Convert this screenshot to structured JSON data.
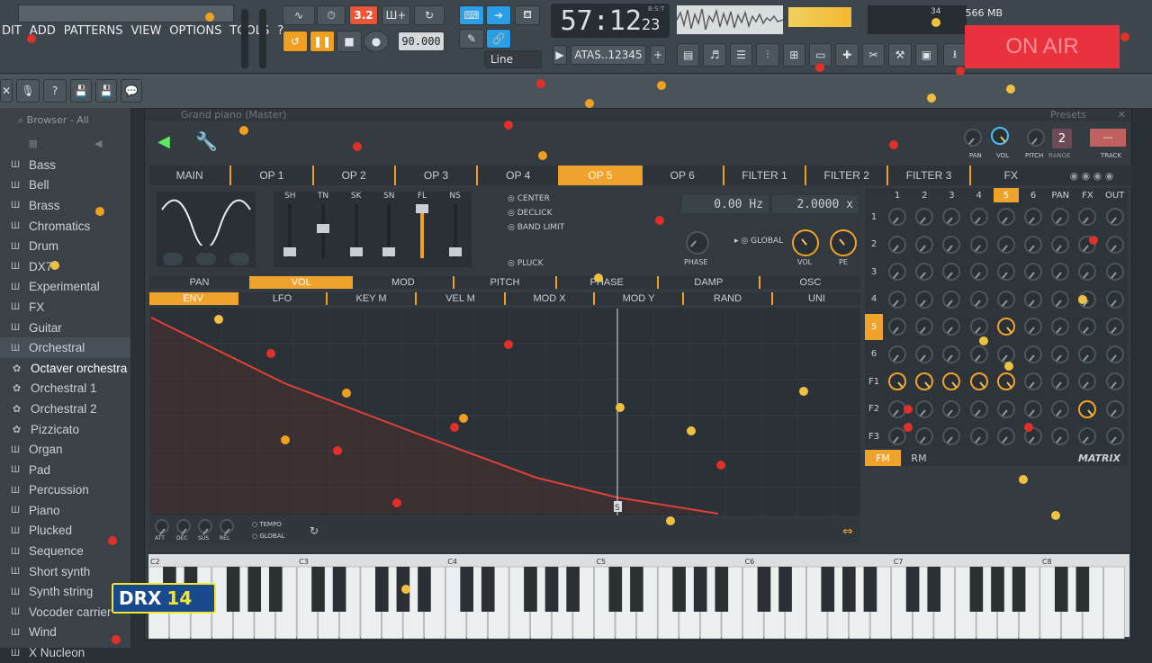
{
  "menu": [
    "DIT",
    "ADD",
    "PATTERNS",
    "VIEW",
    "OPTIONS",
    "TOOLS",
    "?"
  ],
  "transport": {
    "tempo": "90.000",
    "pattern_num": "3.2",
    "time_main": "57:12",
    "time_sub": "23",
    "time_unit": "B:S:T",
    "snap": "Line",
    "song_label": "ATAS..12345",
    "cpu_label": "34",
    "mem_label": "566 MB"
  },
  "on_air": "ON AIR",
  "browser": {
    "header": "Browser - All",
    "items": [
      {
        "label": "Bass",
        "type": "folder"
      },
      {
        "label": "Bell",
        "type": "folder"
      },
      {
        "label": "Brass",
        "type": "folder"
      },
      {
        "label": "Chromatics",
        "type": "folder"
      },
      {
        "label": "Drum",
        "type": "folder"
      },
      {
        "label": "DX7",
        "type": "folder"
      },
      {
        "label": "Experimental",
        "type": "folder"
      },
      {
        "label": "FX",
        "type": "folder"
      },
      {
        "label": "Guitar",
        "type": "folder"
      },
      {
        "label": "Orchestral",
        "type": "folder",
        "state": "selected"
      },
      {
        "label": "Octaver orchestra",
        "type": "preset",
        "state": "active"
      },
      {
        "label": "Orchestral 1",
        "type": "preset"
      },
      {
        "label": "Orchestral 2",
        "type": "preset"
      },
      {
        "label": "Pizzicato",
        "type": "preset"
      },
      {
        "label": "Organ",
        "type": "folder"
      },
      {
        "label": "Pad",
        "type": "folder"
      },
      {
        "label": "Percussion",
        "type": "folder"
      },
      {
        "label": "Piano",
        "type": "folder"
      },
      {
        "label": "Plucked",
        "type": "folder"
      },
      {
        "label": "Sequence",
        "type": "folder"
      },
      {
        "label": "Short synth",
        "type": "folder"
      },
      {
        "label": "Synth string",
        "type": "folder"
      },
      {
        "label": "Vocoder carrier",
        "type": "folder"
      },
      {
        "label": "Wind",
        "type": "folder"
      },
      {
        "label": "X Nucleon",
        "type": "folder"
      }
    ]
  },
  "plugin": {
    "title": "Grand piano (Master)",
    "presets_label": "Presets",
    "head_labels": {
      "pan": "PAN",
      "vol": "VOL",
      "pitch": "PITCH",
      "range": "RANGE",
      "track": "TRACK",
      "range_val": "2"
    },
    "tabs": [
      "MAIN",
      "OP 1",
      "OP 2",
      "OP 3",
      "OP 4",
      "OP 5",
      "OP 6",
      "FILTER 1",
      "FILTER 2",
      "FILTER 3",
      "FX"
    ],
    "active_tab": "OP 5",
    "faders": [
      "SH",
      "TN",
      "SK",
      "SN",
      "FL",
      "NS"
    ],
    "options": [
      "CENTER",
      "DECLICK",
      "BAND LIMIT",
      "PLUCK"
    ],
    "freq": "0.00 Hz",
    "ratio": "2.0000 x",
    "knob_labels": {
      "phase": "PHASE",
      "global": "GLOBAL",
      "vol": "VOL",
      "pe": "PE"
    },
    "subtabs1": [
      "PAN",
      "VOL",
      "MOD",
      "PITCH",
      "PHASE",
      "DAMP",
      "OSC"
    ],
    "active_subtab1": "VOL",
    "subtabs2": [
      "ENV",
      "LFO",
      "KEY M",
      "VEL M",
      "MOD X",
      "MOD Y",
      "RAND",
      "UNI"
    ],
    "active_subtab2": "ENV",
    "env_knobs": [
      "ATT",
      "DEC",
      "SUS",
      "REL"
    ],
    "env_opts": [
      "TEMPO",
      "GLOBAL"
    ],
    "env_marker": "S",
    "matrix": {
      "cols": [
        "1",
        "2",
        "3",
        "4",
        "5",
        "6",
        "PAN",
        "FX",
        "OUT"
      ],
      "rows": [
        "1",
        "2",
        "3",
        "4",
        "5",
        "6",
        "F1",
        "F2",
        "F3"
      ],
      "active_col": "5",
      "active_row": "5",
      "modes": [
        "FM",
        "RM"
      ],
      "active_mode": "FM",
      "label": "MATRIX"
    }
  },
  "keyboard": {
    "octaves": [
      "C2",
      "C3",
      "C4",
      "C5",
      "C6",
      "C7",
      "C8"
    ]
  },
  "logo": {
    "text_a": "DRX",
    "text_b": "14"
  }
}
